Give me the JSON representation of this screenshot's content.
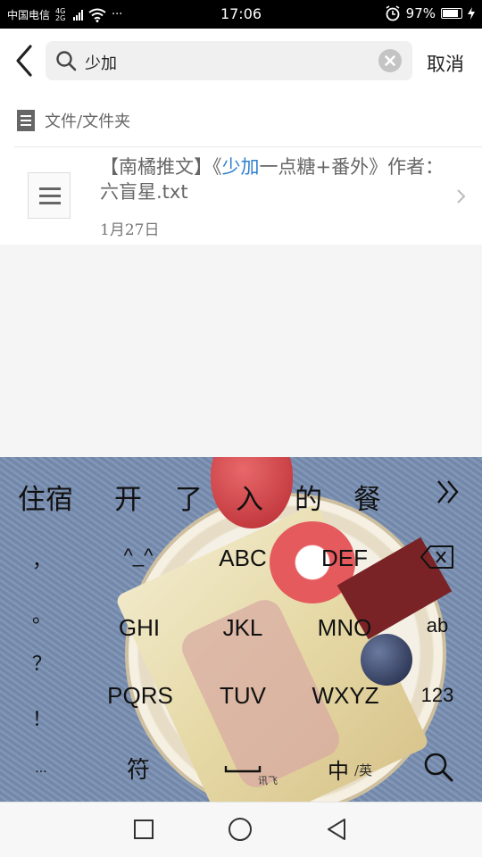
{
  "status_bar": {
    "carrier": "中国电信",
    "network": "4G 2G",
    "time": "17:06",
    "battery": "97%",
    "more_dots": "···"
  },
  "search": {
    "query": "少加",
    "cancel_label": "取消"
  },
  "section": {
    "title": "文件/文件夹",
    "items": [
      {
        "name_before": "【南橘推文】《",
        "name_highlight": "少加",
        "name_after": "一点糖+番外》作者：六盲星.txt",
        "date": "1月27日"
      }
    ]
  },
  "keyboard": {
    "candidates": [
      "住宿",
      "开",
      "了",
      "入",
      "的",
      "餐"
    ],
    "left_column": [
      "，",
      "。",
      "？",
      "！",
      "..."
    ],
    "rows": [
      [
        "^_^",
        "ABC",
        "DEF"
      ],
      [
        "GHI",
        "JKL",
        "MNO"
      ],
      [
        "PQRS",
        "TUV",
        "WXYZ"
      ]
    ],
    "right_column": [
      "ab",
      "123"
    ],
    "bottom": {
      "symbol_label": "符",
      "space_hint": "讯飞",
      "lang_main": "中",
      "lang_sub": "/英"
    }
  },
  "colors": {
    "highlight": "#2f80d1",
    "keyboard_bg": "#7d92b3"
  }
}
